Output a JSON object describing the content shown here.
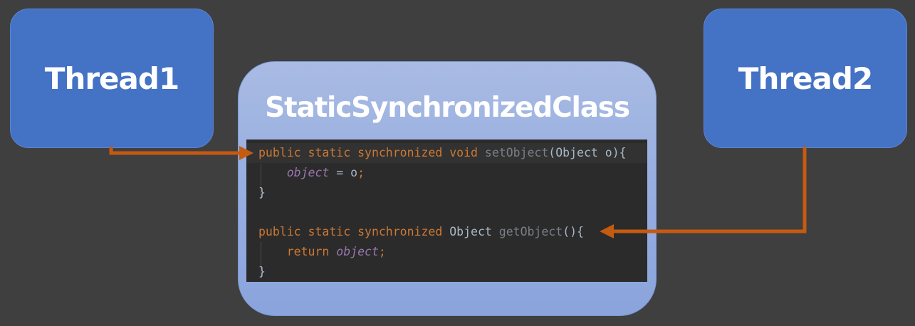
{
  "thread1": {
    "label": "Thread1"
  },
  "thread2": {
    "label": "Thread2"
  },
  "class_box": {
    "title": "StaticSynchronizedClass"
  },
  "code": {
    "set_kw": "public static synchronized void ",
    "set_name": "setObject",
    "set_sig": "(Object o){",
    "set_body_field": "object",
    "set_body_rest": " = o",
    "set_body_semi": ";",
    "set_close": "}",
    "get_kw": "public static synchronized ",
    "get_type": "Object ",
    "get_name": "getObject",
    "get_sig": "(){",
    "get_body_kw": "return ",
    "get_body_field": "object",
    "get_body_semi": ";",
    "get_close": "}"
  },
  "colors": {
    "thread_box": "#4472c4",
    "arrow": "#c55a11",
    "code_bg": "#2b2b2b",
    "keyword": "#cc7832"
  }
}
